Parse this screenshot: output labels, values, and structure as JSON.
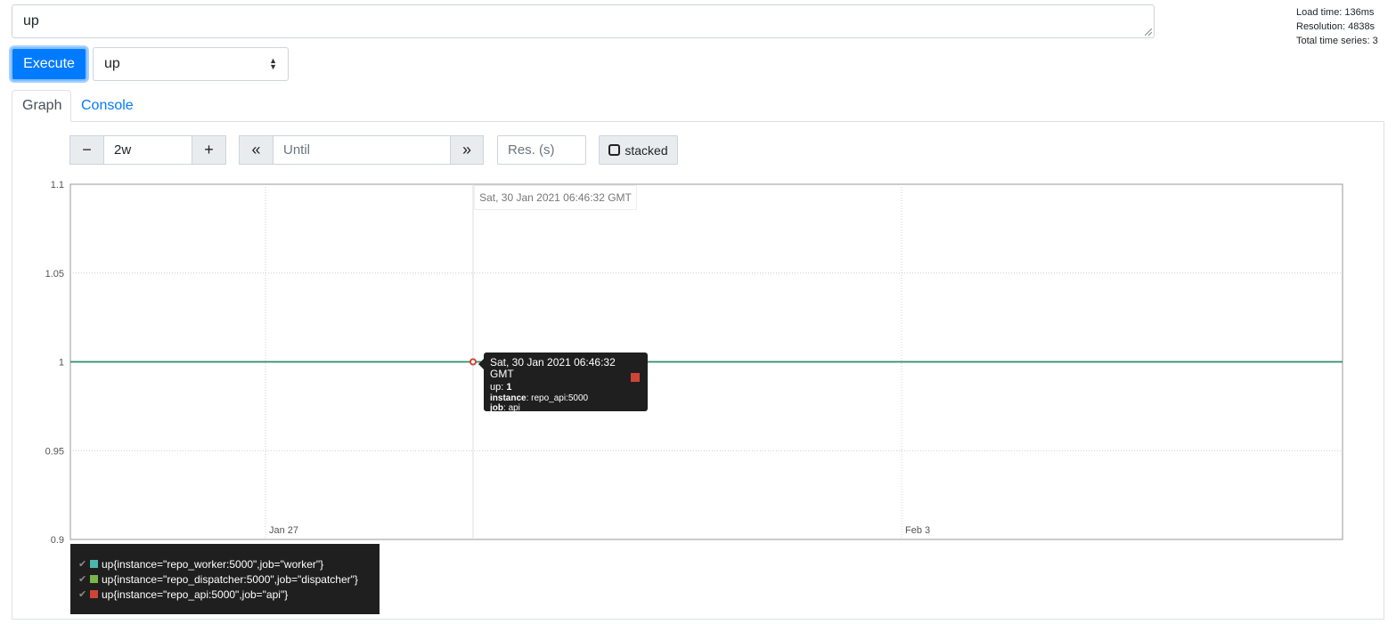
{
  "query": {
    "value": "up"
  },
  "stats": {
    "load_time": "Load time: 136ms",
    "resolution": "Resolution: 4838s",
    "total_series": "Total time series: 3"
  },
  "controls": {
    "execute_label": "Execute",
    "metric_select": "up",
    "tabs": [
      "Graph",
      "Console"
    ],
    "minus": "−",
    "range": "2w",
    "plus": "+",
    "back": "«",
    "until_placeholder": "Until",
    "forward": "»",
    "res_placeholder": "Res. (s)",
    "stacked_label": "stacked"
  },
  "hover": {
    "axis_label": "Sat, 30 Jan 2021 06:46:32 GMT",
    "tooltip": {
      "time": "Sat, 30 Jan 2021 06:46:32 GMT",
      "metric": "up",
      "value": "1",
      "instance_key": "instance",
      "instance": "repo_api:5000",
      "job_key": "job",
      "job": "api"
    }
  },
  "colors": {
    "worker": "#4db6ac",
    "dispatcher": "#7ab648",
    "api": "#d04437",
    "accent": "#007bff",
    "line": "#2e8b7a"
  },
  "chart_data": {
    "type": "line",
    "ylim": [
      0.9,
      1.1
    ],
    "yticks": [
      "0.9",
      "0.95",
      "1",
      "1.05",
      "1.1"
    ],
    "xticks": [
      "Jan 27",
      "Feb 3"
    ],
    "grid": true,
    "legend_placement": "bottom-left",
    "series": [
      {
        "name": "up{instance=\"repo_worker:5000\",job=\"worker\"}",
        "color": "#4db6ac",
        "value": 1
      },
      {
        "name": "up{instance=\"repo_dispatcher:5000\",job=\"dispatcher\"}",
        "color": "#7ab648",
        "value": 1
      },
      {
        "name": "up{instance=\"repo_api:5000\",job=\"api\"}",
        "color": "#d04437",
        "value": 1
      }
    ]
  }
}
